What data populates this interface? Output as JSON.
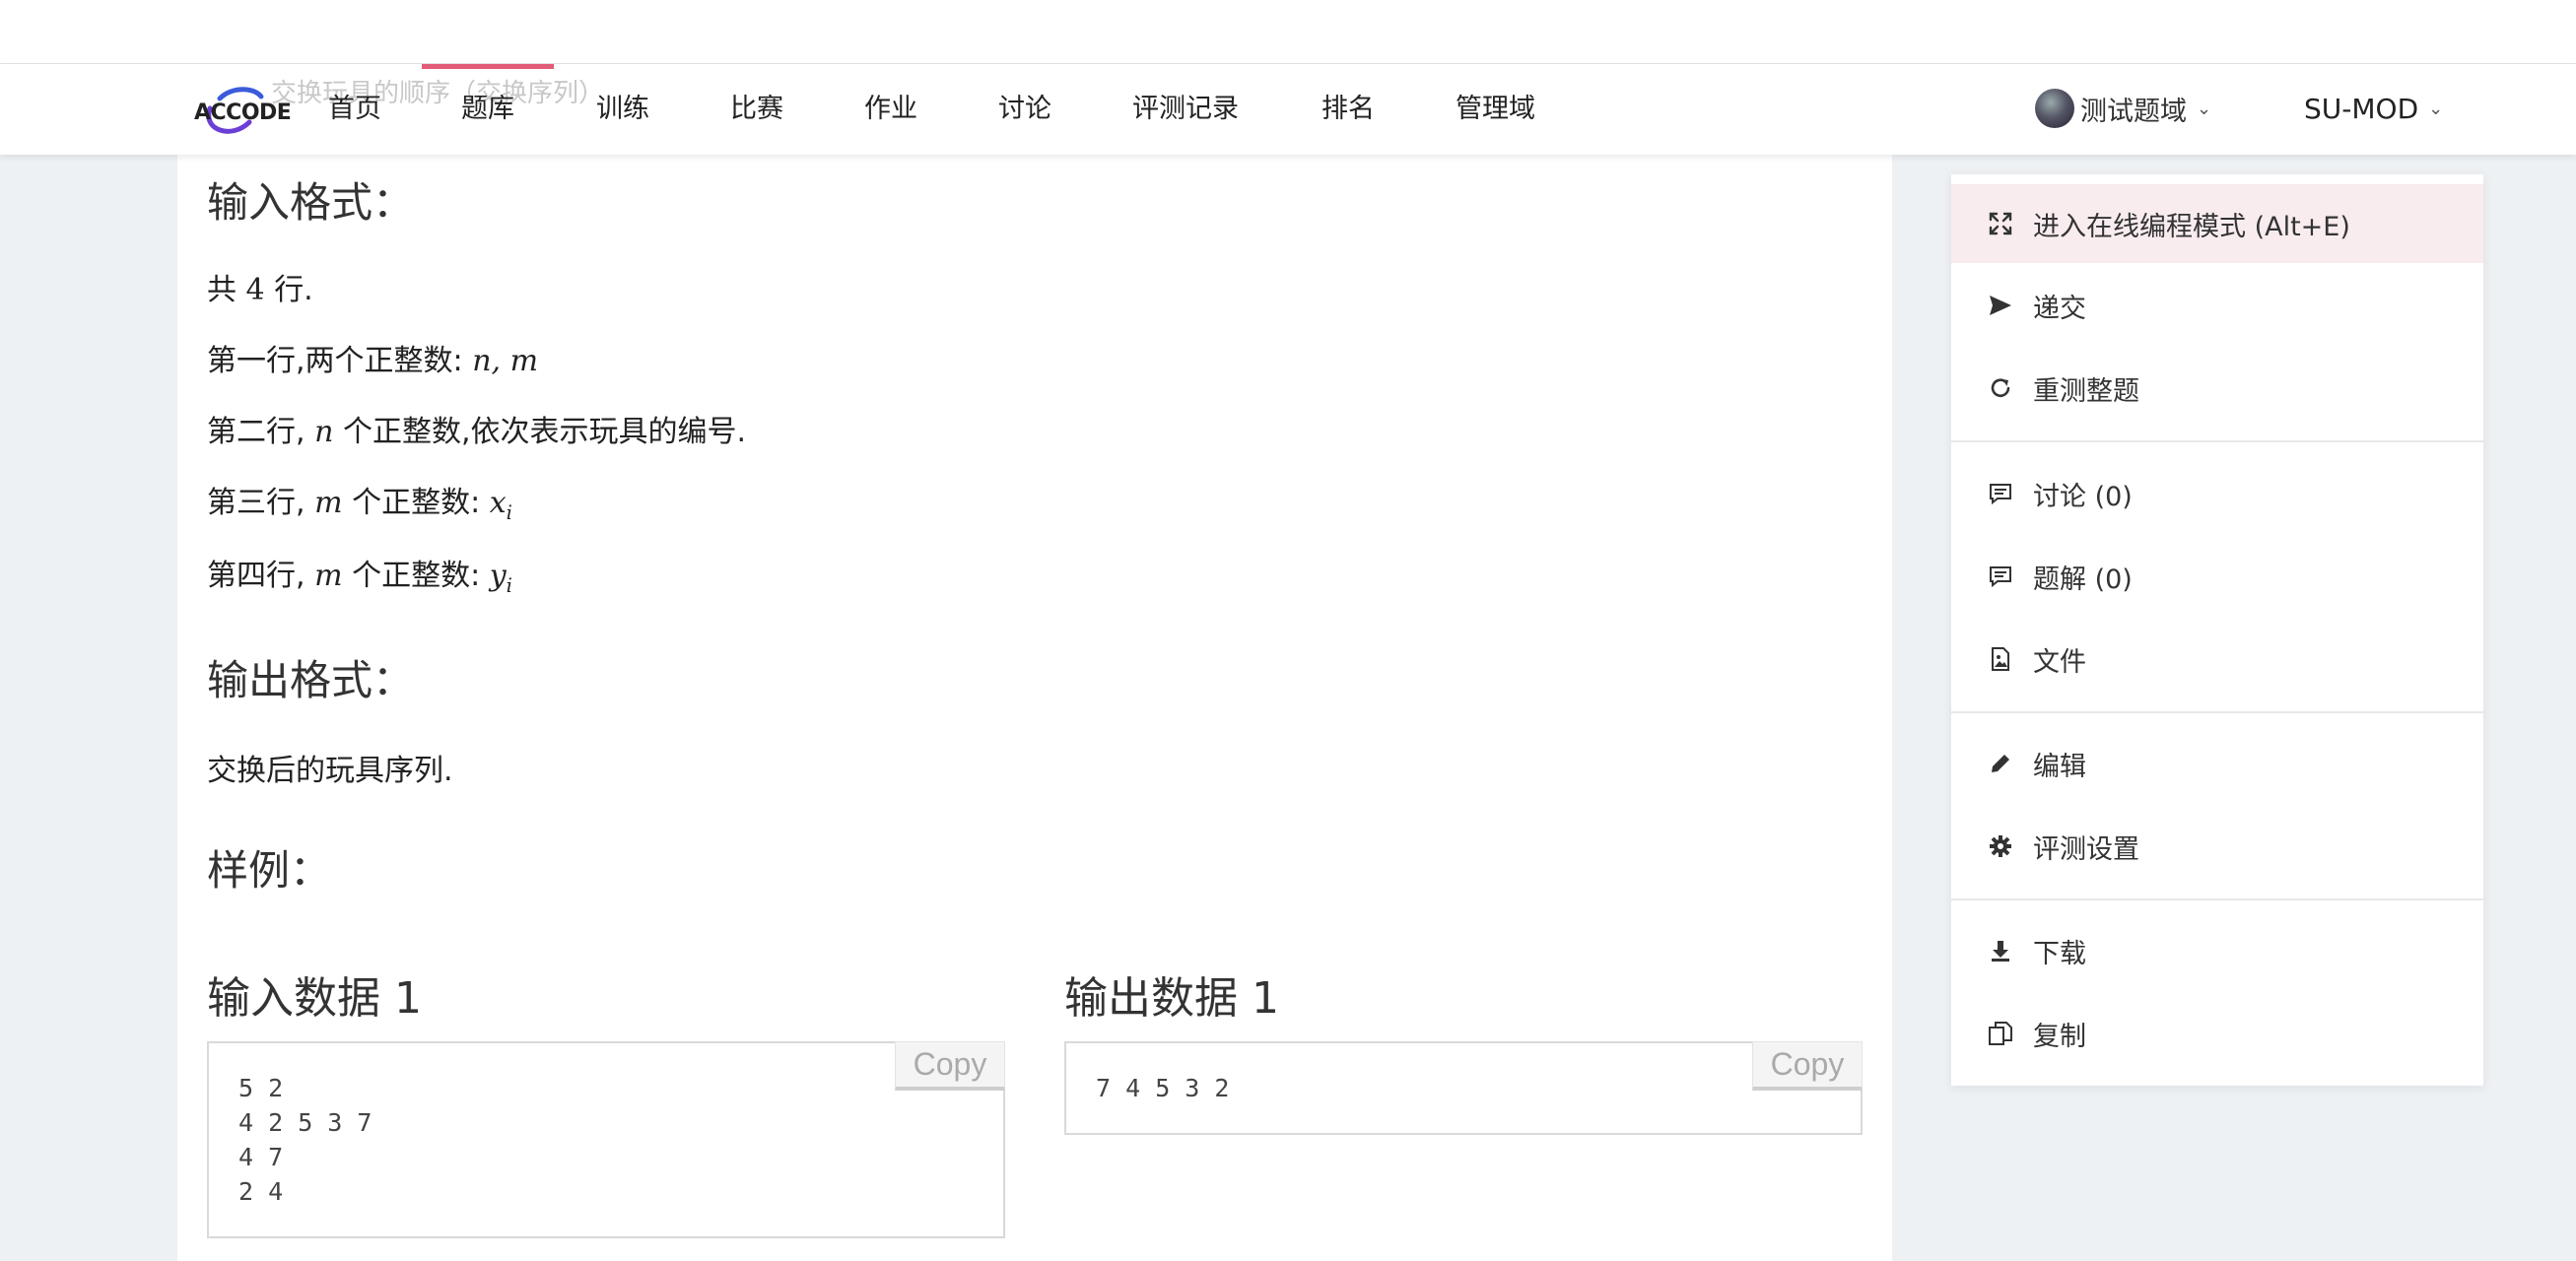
{
  "nav": {
    "logo_text": "ACCODE",
    "faded_title": "交换玩具的顺序（交换序列）",
    "items": [
      "首页",
      "题库",
      "训练",
      "比赛",
      "作业",
      "讨论",
      "评测记录",
      "排名",
      "管理域"
    ],
    "active_index": 1,
    "domain_label": "测试题域",
    "user_label": "SU-MOD",
    "accent_color": "#e25b77"
  },
  "problem": {
    "input_heading": "输入格式：",
    "input_lines": {
      "line1_pre": "共",
      "line1_num": "4",
      "line1_post": "行.",
      "line2_pre": "第一行,两个正整数: ",
      "line2_math": "n, m",
      "line3_pre": "第二行, ",
      "line3_math": "n",
      "line3_post": " 个正整数,依次表示玩具的编号.",
      "line4_pre": "第三行, ",
      "line4_math": "m",
      "line4_mid": " 个正整数: ",
      "line4_var": "x",
      "line4_sub": "i",
      "line5_pre": "第四行, ",
      "line5_math": "m",
      "line5_mid": " 个正整数: ",
      "line5_var": "y",
      "line5_sub": "i"
    },
    "output_heading": "输出格式：",
    "output_text": "交换后的玩具序列.",
    "sample_heading": "样例：",
    "sample_input_title": "输入数据 1",
    "sample_input": "5 2\n4 2 5 3 7\n4 7\n2 4",
    "sample_output_title": "输出数据 1",
    "sample_output": "7 4 5 3 2",
    "copy_label": "Copy"
  },
  "menu": {
    "items": [
      {
        "label": "进入在线编程模式 (Alt+E)",
        "icon": "expand-icon"
      },
      {
        "label": "递交",
        "icon": "send-icon"
      },
      {
        "label": "重测整题",
        "icon": "refresh-icon"
      },
      {
        "label": "讨论 (0)",
        "icon": "comment-icon"
      },
      {
        "label": "题解 (0)",
        "icon": "comment-icon"
      },
      {
        "label": "文件",
        "icon": "file-image-icon"
      },
      {
        "label": "编辑",
        "icon": "pencil-icon"
      },
      {
        "label": "评测设置",
        "icon": "gear-icon"
      },
      {
        "label": "下载",
        "icon": "download-icon"
      },
      {
        "label": "复制",
        "icon": "copy-icon"
      }
    ],
    "highlight_color": "#f8ecef"
  }
}
